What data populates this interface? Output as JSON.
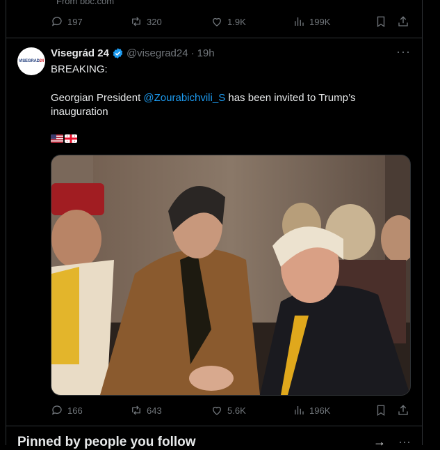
{
  "previous_tweet": {
    "source_text": "From bbc.com",
    "stats": {
      "replies": "197",
      "reposts": "320",
      "likes": "1.9K",
      "views": "199K"
    }
  },
  "tweet": {
    "author_name": "Visegrád 24",
    "author_handle": "@visegrad24",
    "dot": "·",
    "time": "19h",
    "avatar_text_main": "VISEGRAD",
    "avatar_text_num": "24",
    "text_line1": "BREAKING:",
    "text_line2_pre": "Georgian President ",
    "text_mention": "@Zourabichvili_S",
    "text_line2_post": " has been invited to Trump’s inauguration",
    "flags": [
      "us-flag",
      "georgia-flag"
    ],
    "stats": {
      "replies": "166",
      "reposts": "643",
      "likes": "5.6K",
      "views": "196K"
    },
    "verified_color": "#1d9bf0"
  },
  "next_section": {
    "title": "Pinned by people you follow",
    "arrow": "→",
    "more": "···"
  },
  "more_glyph": "···",
  "colors": {
    "background": "#000000",
    "text": "#e7e9ea",
    "muted": "#71767b",
    "accent": "#1d9bf0",
    "border": "#2f3336"
  }
}
